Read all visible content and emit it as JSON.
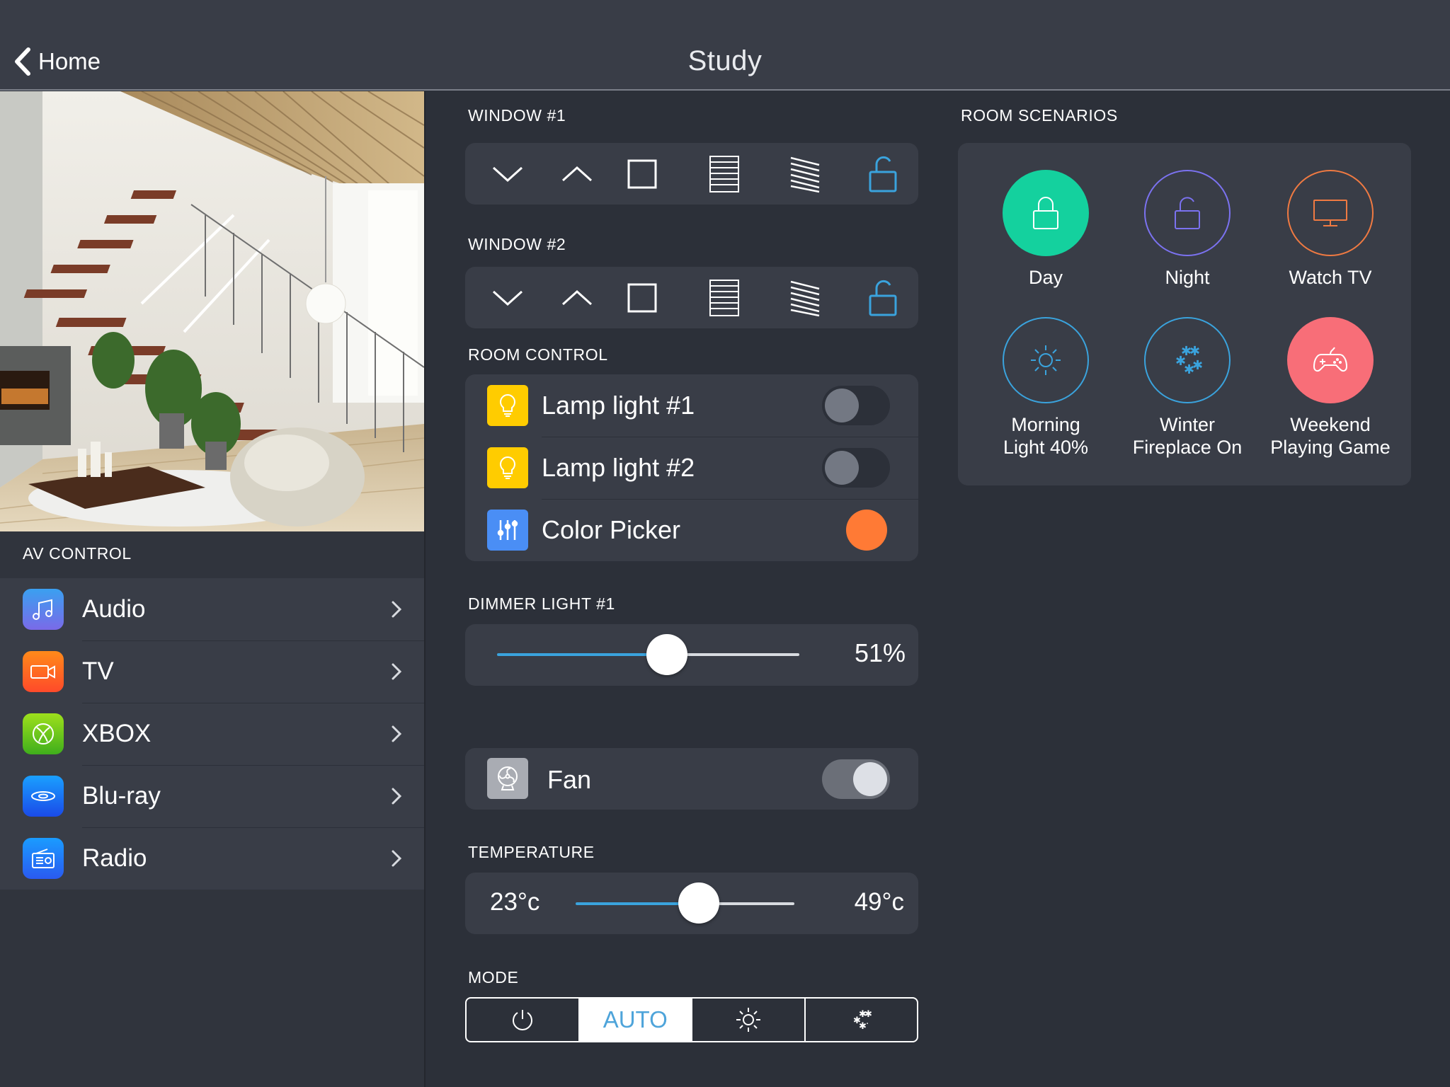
{
  "header": {
    "back_label": "Home",
    "title": "Study"
  },
  "av_control": {
    "title": "AV CONTROL",
    "items": [
      {
        "label": "Audio",
        "icon": "music-note-icon"
      },
      {
        "label": "TV",
        "icon": "video-camera-icon"
      },
      {
        "label": "XBOX",
        "icon": "xbox-logo-icon"
      },
      {
        "label": "Blu-ray",
        "icon": "bluray-disc-icon"
      },
      {
        "label": "Radio",
        "icon": "radio-icon"
      }
    ]
  },
  "windows": [
    {
      "title": "WINDOW #1",
      "buttons": [
        "chevron-down-icon",
        "chevron-up-icon",
        "stop-square-icon",
        "blinds-closed-icon",
        "blinds-tilted-icon",
        "unlock-icon"
      ]
    },
    {
      "title": "WINDOW #2",
      "buttons": [
        "chevron-down-icon",
        "chevron-up-icon",
        "stop-square-icon",
        "blinds-closed-icon",
        "blinds-tilted-icon",
        "unlock-icon"
      ]
    }
  ],
  "room_control": {
    "title": "ROOM CONTROL",
    "items": [
      {
        "label": "Lamp light #1",
        "type": "toggle",
        "state": "off"
      },
      {
        "label": "Lamp light #2",
        "type": "toggle",
        "state": "off"
      },
      {
        "label": "Color Picker",
        "type": "color",
        "color": "#ff7a35"
      }
    ]
  },
  "dimmer": {
    "title": "DIMMER LIGHT #1",
    "value_label": "51%",
    "value": 51
  },
  "fan": {
    "label": "Fan",
    "state": "on"
  },
  "temperature": {
    "title": "TEMPERATURE",
    "min_label": "23°c",
    "max_label": "49°c"
  },
  "mode": {
    "title": "MODE",
    "active_label": "AUTO",
    "segments": [
      "power-icon",
      "AUTO",
      "sun-icon",
      "snowflake-icon"
    ]
  },
  "scenarios": {
    "title": "ROOM SCENARIOS",
    "items": [
      {
        "line1": "Day",
        "line2": "",
        "icon": "lock-icon",
        "color": "#14d19e"
      },
      {
        "line1": "Night",
        "line2": "",
        "icon": "unlock-icon",
        "color": "#7b72f0"
      },
      {
        "line1": "Watch TV",
        "line2": "",
        "icon": "monitor-icon",
        "color": "#f07a42"
      },
      {
        "line1": "Morning",
        "line2": "Light 40%",
        "icon": "sun-icon",
        "color": "#3aa3dd"
      },
      {
        "line1": "Winter",
        "line2": "Fireplace On",
        "icon": "snowflake-icon",
        "color": "#3aa3dd"
      },
      {
        "line1": "Weekend",
        "line2": "Playing Game",
        "icon": "gamepad-icon",
        "color": "#f86e78"
      }
    ]
  },
  "colors": {
    "accent_blue": "#4ea4da",
    "lamp_yellow": "#ffcc00",
    "background": "#2c3039",
    "card": "#393d47"
  }
}
